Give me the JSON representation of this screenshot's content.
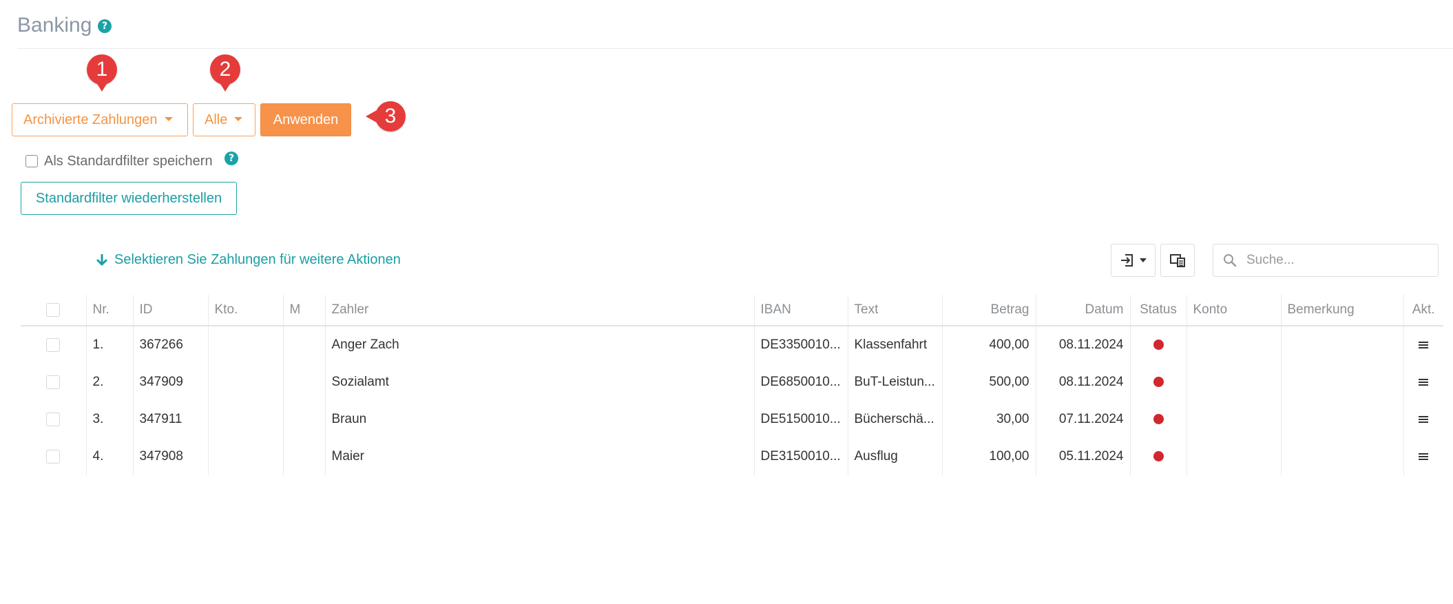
{
  "header": {
    "title": "Banking",
    "help_glyph": "?"
  },
  "markers": [
    "1",
    "2",
    "3"
  ],
  "filters": {
    "archive_label": "Archivierte Zahlungen",
    "status_label": "Alle",
    "apply_label": "Anwenden",
    "save_default_label": "Als Standardfilter speichern",
    "save_default_checked": false,
    "restore_label": "Standardfilter wiederherstellen"
  },
  "toolbar": {
    "select_hint": "Selektieren Sie Zahlungen für weitere Aktionen",
    "search_placeholder": "Suche...",
    "export_icon": "export-icon",
    "columns_icon": "columns-icon"
  },
  "table": {
    "columns": [
      "Nr.",
      "ID",
      "Kto.",
      "M",
      "Zahler",
      "IBAN",
      "Text",
      "Betrag",
      "Datum",
      "Status",
      "Konto",
      "Bemerkung",
      "Akt."
    ],
    "rows": [
      {
        "nr": "1.",
        "id": "367266",
        "kto": "",
        "m": "",
        "zahler": "Anger Zach",
        "iban": "DE3350010...",
        "text": "Klassenfahrt",
        "betrag": "400,00",
        "datum": "08.11.2024",
        "status": "red",
        "konto": "",
        "bemerkung": ""
      },
      {
        "nr": "2.",
        "id": "347909",
        "kto": "",
        "m": "",
        "zahler": "Sozialamt",
        "iban": "DE6850010...",
        "text": "BuT-Leistun...",
        "betrag": "500,00",
        "datum": "08.11.2024",
        "status": "red",
        "konto": "",
        "bemerkung": ""
      },
      {
        "nr": "3.",
        "id": "347911",
        "kto": "",
        "m": "",
        "zahler": "Braun",
        "iban": "DE5150010...",
        "text": "Bücherschä...",
        "betrag": "30,00",
        "datum": "07.11.2024",
        "status": "red",
        "konto": "",
        "bemerkung": ""
      },
      {
        "nr": "4.",
        "id": "347908",
        "kto": "",
        "m": "",
        "zahler": "Maier",
        "iban": "DE3150010...",
        "text": "Ausflug",
        "betrag": "100,00",
        "datum": "05.11.2024",
        "status": "red",
        "konto": "",
        "bemerkung": ""
      }
    ]
  },
  "colors": {
    "accent_orange": "#f7924a",
    "accent_teal": "#1aa3a7",
    "marker_red": "#e53b3b",
    "status_red": "#d0282e"
  }
}
